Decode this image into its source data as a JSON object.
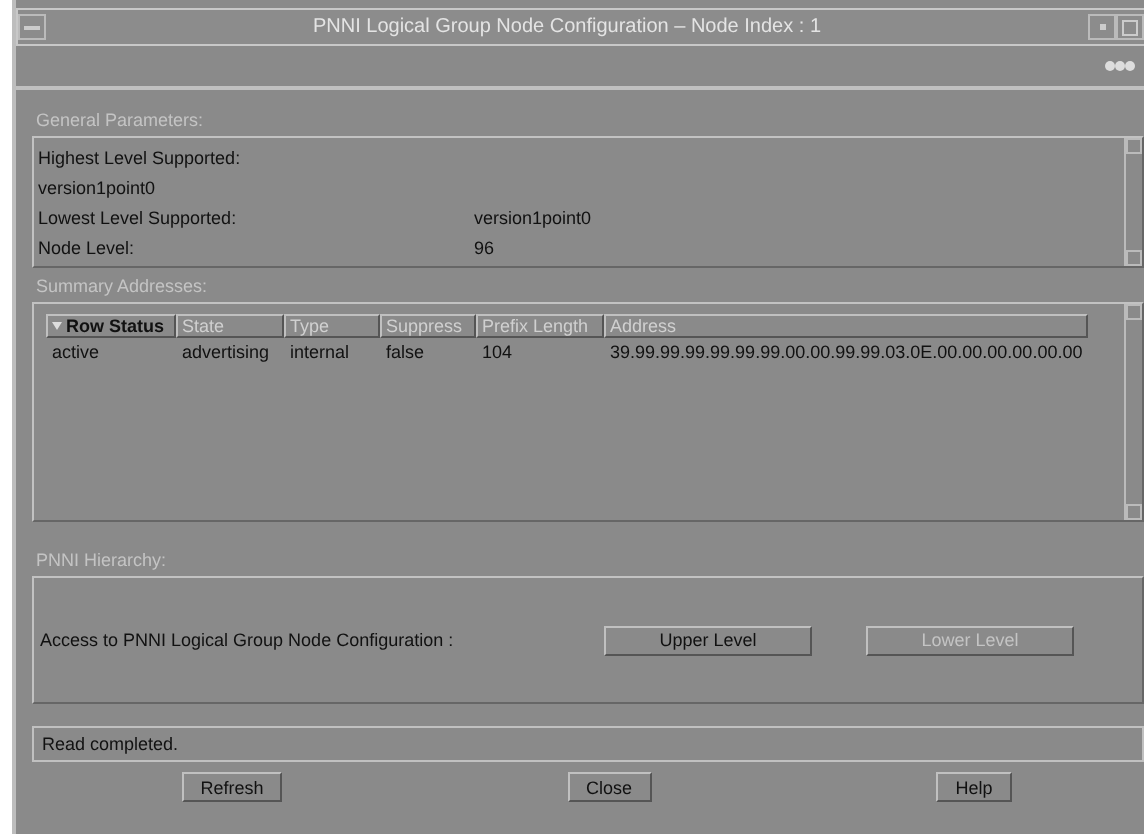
{
  "window": {
    "title": "PNNI Logical Group Node Configuration – Node Index : 1"
  },
  "general": {
    "label": "General Parameters:",
    "rows": [
      {
        "name": "Highest Level Supported:",
        "value": ""
      },
      {
        "name": "version1point0",
        "value": ""
      },
      {
        "name": "Lowest Level Supported:",
        "value": "version1point0"
      },
      {
        "name": "Node Level:",
        "value": "96"
      }
    ]
  },
  "summary": {
    "label": "Summary Addresses:",
    "columns": [
      {
        "label": "Row Status",
        "sorted": true
      },
      {
        "label": "State",
        "sorted": false
      },
      {
        "label": "Type",
        "sorted": false
      },
      {
        "label": "Suppress",
        "sorted": false
      },
      {
        "label": "Prefix Length",
        "sorted": false
      },
      {
        "label": "Address",
        "sorted": false
      }
    ],
    "rows": [
      [
        "active",
        "advertising",
        "internal",
        "false",
        "104",
        "39.99.99.99.99.99.99.00.00.99.99.03.0E.00.00.00.00.00.00"
      ]
    ]
  },
  "hierarchy": {
    "label": "PNNI Hierarchy:",
    "text": "Access to PNNI Logical Group Node Configuration :",
    "buttons": [
      {
        "label": "Upper Level",
        "disabled": false
      },
      {
        "label": "Lower Level",
        "disabled": true
      }
    ]
  },
  "status_bar": "Read completed.",
  "buttons": [
    "Refresh",
    "Close",
    "Help"
  ]
}
